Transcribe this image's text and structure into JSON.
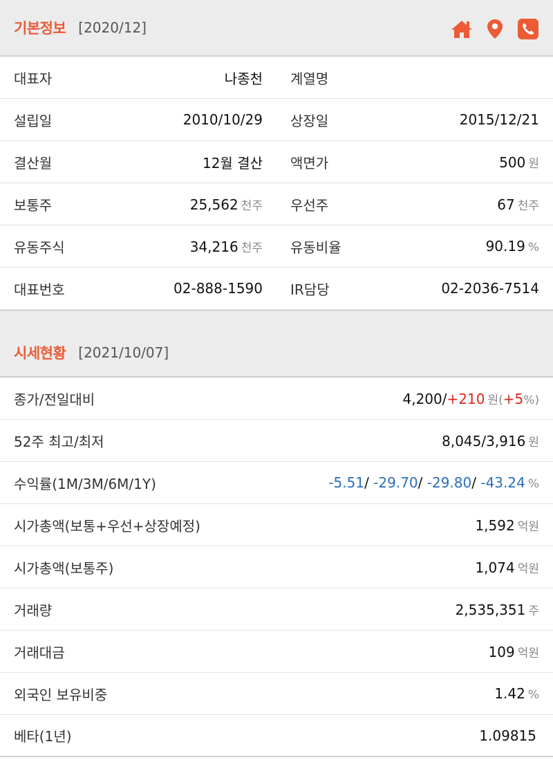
{
  "basic": {
    "title": "기본정보",
    "date": "[2020/12]",
    "icons": [
      "home-icon",
      "location-pin-icon",
      "phone-icon"
    ],
    "accent": "#ec5b35",
    "rows": [
      {
        "l1": "대표자",
        "v1": "나종천",
        "u1": "",
        "l2": "계열명",
        "v2": "",
        "u2": ""
      },
      {
        "l1": "설립일",
        "v1": "2010/10/29",
        "u1": "",
        "l2": "상장일",
        "v2": "2015/12/21",
        "u2": ""
      },
      {
        "l1": "결산월",
        "v1": "12월 결산",
        "u1": "",
        "l2": "액면가",
        "v2": "500",
        "u2": "원"
      },
      {
        "l1": "보통주",
        "v1": "25,562",
        "u1": "천주",
        "l2": "우선주",
        "v2": "67",
        "u2": "천주"
      },
      {
        "l1": "유동주식",
        "v1": "34,216",
        "u1": "천주",
        "l2": "유동비율",
        "v2": "90.19",
        "u2": "%"
      },
      {
        "l1": "대표번호",
        "v1": "02-888-1590",
        "u1": "",
        "l2": "IR담당",
        "v2": "02-2036-7514",
        "u2": ""
      }
    ]
  },
  "market": {
    "title": "시세현황",
    "date": "[2021/10/07]",
    "price": {
      "label": "종가/전일대비",
      "close": "4,200",
      "slash": "/",
      "change": "+210",
      "unit": "원",
      "open_paren": "(",
      "pct": "+5",
      "pct_unit": "%",
      "close_paren": ")"
    },
    "range": {
      "label": "52주 최고/최저",
      "value": "8,045/3,916",
      "unit": "원"
    },
    "returns": {
      "label": "수익률(1M/3M/6M/1Y)",
      "r1": "-5.51",
      "r2": "-29.70",
      "r3": "-29.80",
      "r4": "-43.24",
      "sep": "/",
      "unit": "%"
    },
    "rows": [
      {
        "label": "시가총액(보통+우선+상장예정)",
        "value": "1,592",
        "unit": "억원"
      },
      {
        "label": "시가총액(보통주)",
        "value": "1,074",
        "unit": "억원"
      },
      {
        "label": "거래량",
        "value": "2,535,351",
        "unit": "주"
      },
      {
        "label": "거래대금",
        "value": "109",
        "unit": "억원"
      },
      {
        "label": "외국인 보유비중",
        "value": "1.42",
        "unit": "%"
      },
      {
        "label": "베타(1년)",
        "value": "1.09815",
        "unit": ""
      }
    ]
  }
}
